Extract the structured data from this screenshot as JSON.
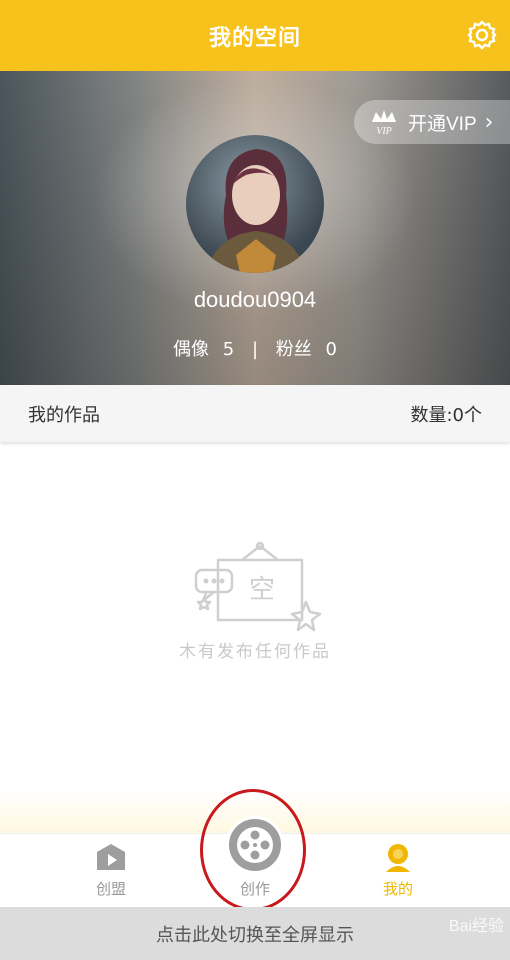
{
  "header": {
    "title": "我的空间",
    "settings_icon": "gear-icon"
  },
  "vip": {
    "badge_text": "VIP",
    "label": "开通VIP",
    "chevron": "›"
  },
  "profile": {
    "username": "doudou0904",
    "idols_label": "偶像",
    "idols_count": "5",
    "separator": "|",
    "fans_label": "粉丝",
    "fans_count": "0"
  },
  "works": {
    "title": "我的作品",
    "count_text": "数量:0个"
  },
  "empty": {
    "illustration_text": "空",
    "message": "木有发布任何作品"
  },
  "tabs": [
    {
      "label": "创盟",
      "icon": "play-icon"
    },
    {
      "label": "创作",
      "icon": "film-reel-icon"
    },
    {
      "label": "我的",
      "icon": "user-icon"
    }
  ],
  "colors": {
    "brand": "#f8c21d",
    "active_tab": "#f0b700",
    "annotation": "#c8191e"
  },
  "bottom_bar": {
    "text": "点击此处切换至全屏显示"
  },
  "watermark": {
    "text": "Bai经验"
  }
}
